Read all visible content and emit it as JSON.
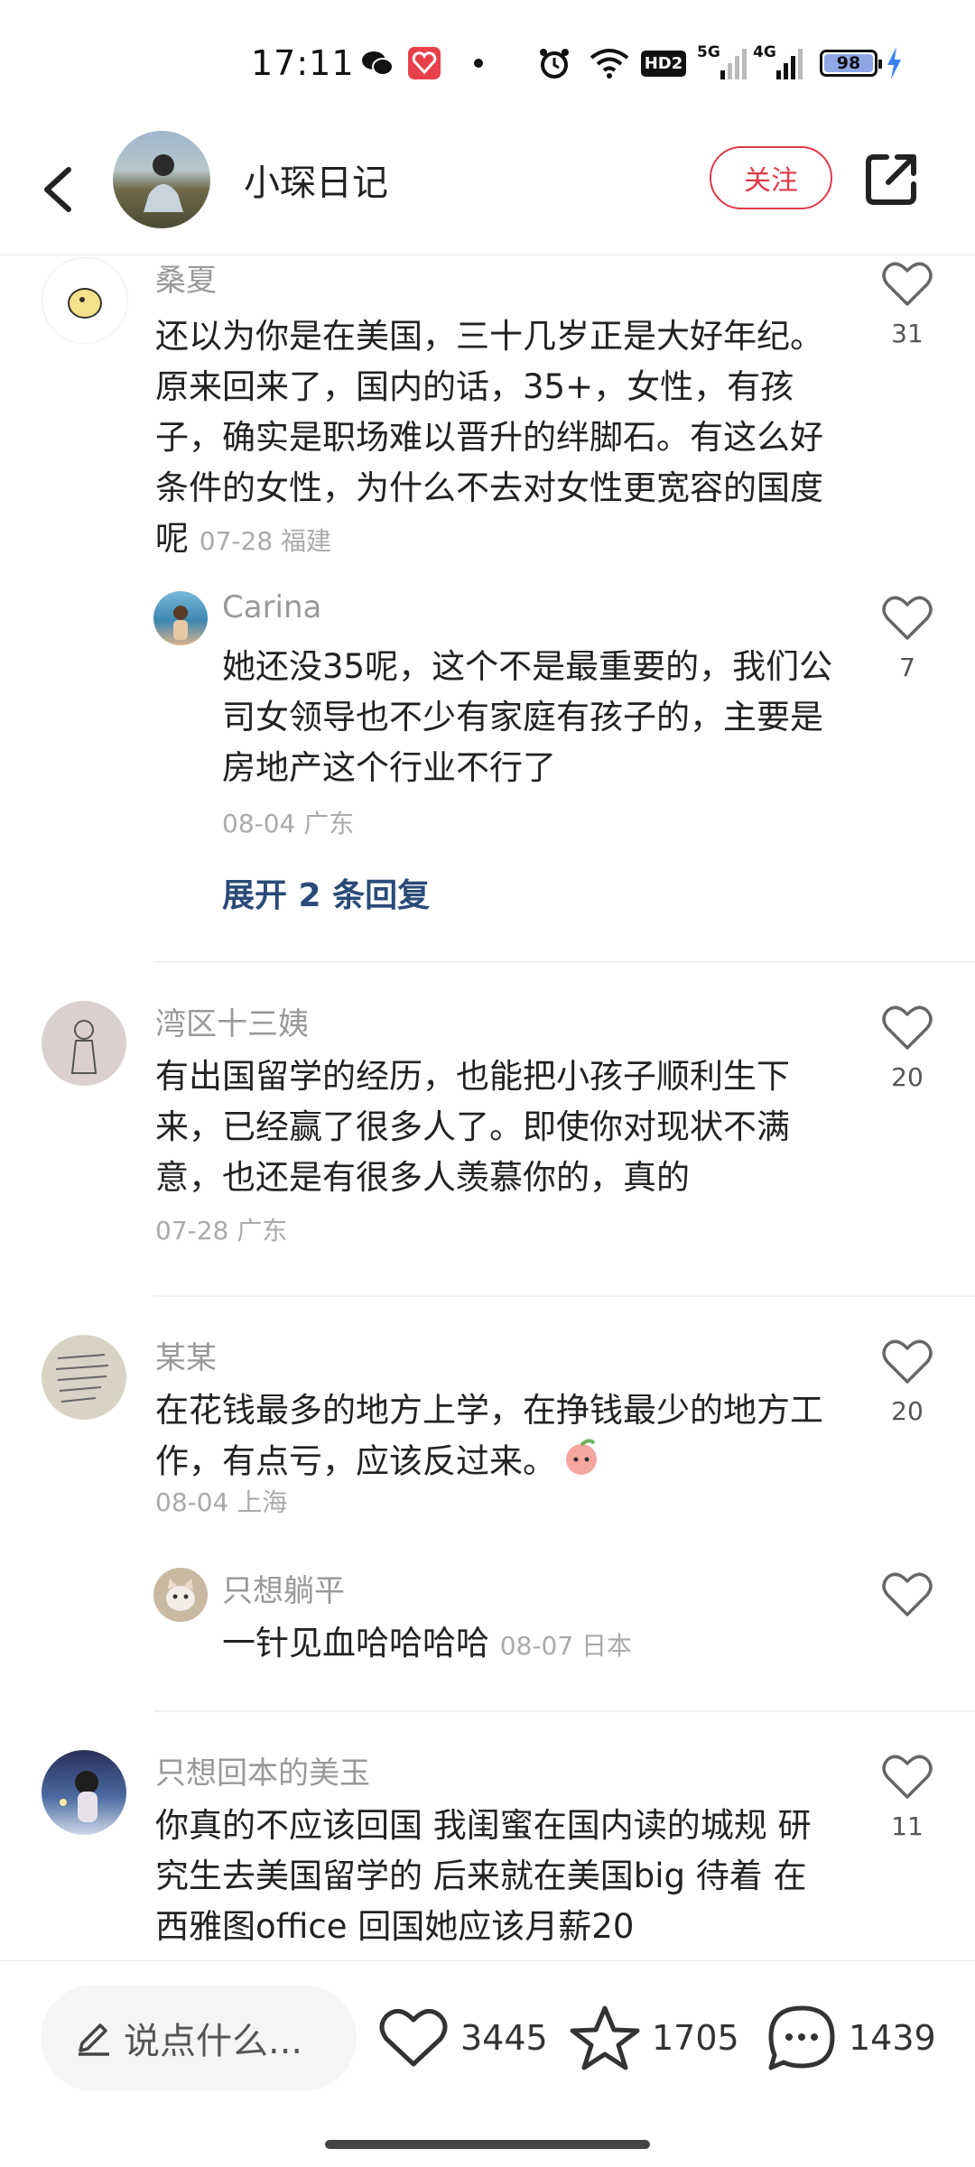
{
  "status_bar": {
    "time": "17:11",
    "network_5g": "5G",
    "network_4g": "4G",
    "battery": "98",
    "hd": "HD2"
  },
  "header": {
    "title": "小琛日记",
    "follow_label": "关注"
  },
  "comments": [
    {
      "name": "桑夏",
      "text": "还以为你是在美国，三十几岁正是大好年纪。原来回来了，国内的话，35+，女性，有孩子，确实是职场难以晋升的绊脚石。有这么好条件的女性，为什么不去对女性更宽容的国度呢",
      "meta": "07-28 福建",
      "likes": "31"
    },
    {
      "name": "Carina",
      "text": "她还没35呢，这个不是最重要的，我们公司女领导也不少有家庭有孩子的，主要是房地产这个行业不行了",
      "meta": "08-04 广东",
      "likes": "7"
    },
    {
      "name": "湾区十三姨",
      "text": "有出国留学的经历，也能把小孩子顺利生下来，已经赢了很多人了。即使你对现状不满意，也还是有很多人羡慕你的，真的",
      "meta": "07-28 广东",
      "likes": "20"
    },
    {
      "name": "某某",
      "text": "在花钱最多的地方上学，在挣钱最少的地方工作，有点亏，应该反过来。",
      "meta": "08-04 上海",
      "likes": "20"
    },
    {
      "name": "只想躺平",
      "text": "一针见血哈哈哈哈",
      "meta": "08-07 日本",
      "likes": ""
    },
    {
      "name": "只想回本的美玉",
      "text": "你真的不应该回国 我闺蜜在国内读的城规 研究生去美国留学的 后来就在美国big 待着 在西雅图office 回国她应该月薪20",
      "meta": "",
      "likes": "11"
    }
  ],
  "expand_replies": "展开 2 条回复",
  "bottom_bar": {
    "input_placeholder": "说点什么...",
    "likes": "3445",
    "favorites": "1705",
    "comments": "1439"
  },
  "icons": [
    "back-icon",
    "share-icon",
    "heart-icon",
    "star-icon",
    "comment-icon",
    "pencil-icon",
    "wechat-icon",
    "alarm-icon",
    "wifi-icon",
    "battery-icon"
  ],
  "colors": {
    "accent": "#e03a4a",
    "link": "#2a4a78",
    "meta": "#aaaaaa"
  }
}
